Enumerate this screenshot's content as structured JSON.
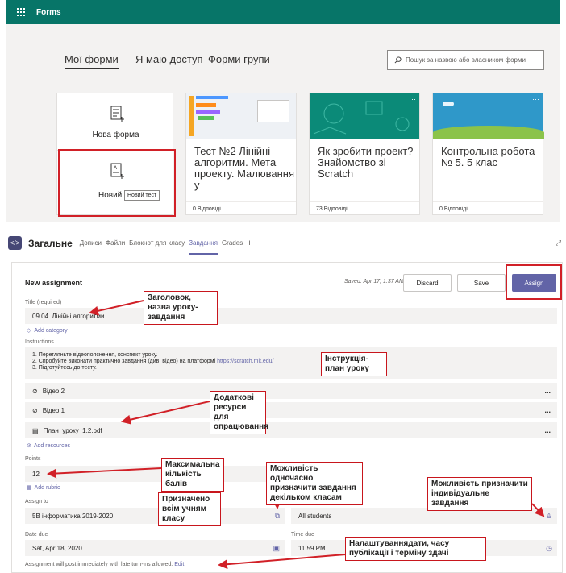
{
  "forms": {
    "app_title": "Forms",
    "tabs": [
      "Мої форми",
      "Я маю доступ",
      "Форми групи"
    ],
    "search_placeholder": "Пошук за назвою або власником форми",
    "new_form_label": "Нова форма",
    "new_quiz_label": "Новий",
    "new_quiz_tooltip": "Новий тест",
    "cards": [
      {
        "title": "Тест №2 Лінійні алгоритми. Мета проекту. Малювання у",
        "responses": "0 Відповіді"
      },
      {
        "title": "Як зробити проект? Знайомство зі Scratch",
        "responses": "73 Відповіді"
      },
      {
        "title": "Контрольна робота № 5. 5 клас",
        "responses": "0 Відповіді"
      }
    ]
  },
  "teams": {
    "channel": "Загальне",
    "tabs": [
      "Дописи",
      "Файли",
      "Блокнот для класу",
      "Завдання",
      "Grades"
    ],
    "active_tab": "Завдання",
    "add_tab": "+",
    "assignment": {
      "header": "New assignment",
      "saved": "Saved: Apr 17, 1:37 AM",
      "discard": "Discard",
      "save": "Save",
      "assign": "Assign",
      "title_label": "Title (required)",
      "title_value": "09.04. Лінійні алгоритми",
      "add_category": "Add category",
      "instructions_label": "Instructions",
      "instructions_line1": "1. Перегляньте відеопояснення, конспект уроку.",
      "instructions_line2": "2. Спробуйте виконати практично завдання (див. відео) на платформі",
      "instructions_link": "https://scratch.mit.edu/",
      "instructions_line3": "3. Підготуйтесь до тесту.",
      "resources": [
        "Відео 2",
        "Відео 1",
        "План_уроку_1.2.pdf"
      ],
      "resource_more": "...",
      "add_resources": "Add resources",
      "points_label": "Points",
      "points_value": "12",
      "add_rubric": "Add rubric",
      "assign_to_label": "Assign to",
      "assign_to_value": "5В інформатика 2019-2020",
      "students_value": "All students",
      "date_due_label": "Date due",
      "date_due_value": "Sat, Apr 18, 2020",
      "time_due_label": "Time due",
      "time_due_value": "11:59 PM",
      "footer": "Assignment will post immediately with late turn-ins allowed.",
      "edit": "Edit"
    }
  },
  "callouts": {
    "title": "Заголовок, назва уроку-завдання",
    "instructions": "Інструкція-план уроку",
    "resources": "Додаткові ресурси для опрацювання",
    "points": "Максимальна кількість балів",
    "multiclass": "Можливість одночасно призначити завдання декільком класам",
    "individual": "Можливість призначити індивідуальне завдання",
    "all_students": "Призначено всім учням класу",
    "dates": "Налаштуваннядати, часу публікації і терміну здачі"
  },
  "colors": {
    "forms_green": "#077568",
    "teams_purple": "#6264a7",
    "annotation_red": "#d12027"
  }
}
